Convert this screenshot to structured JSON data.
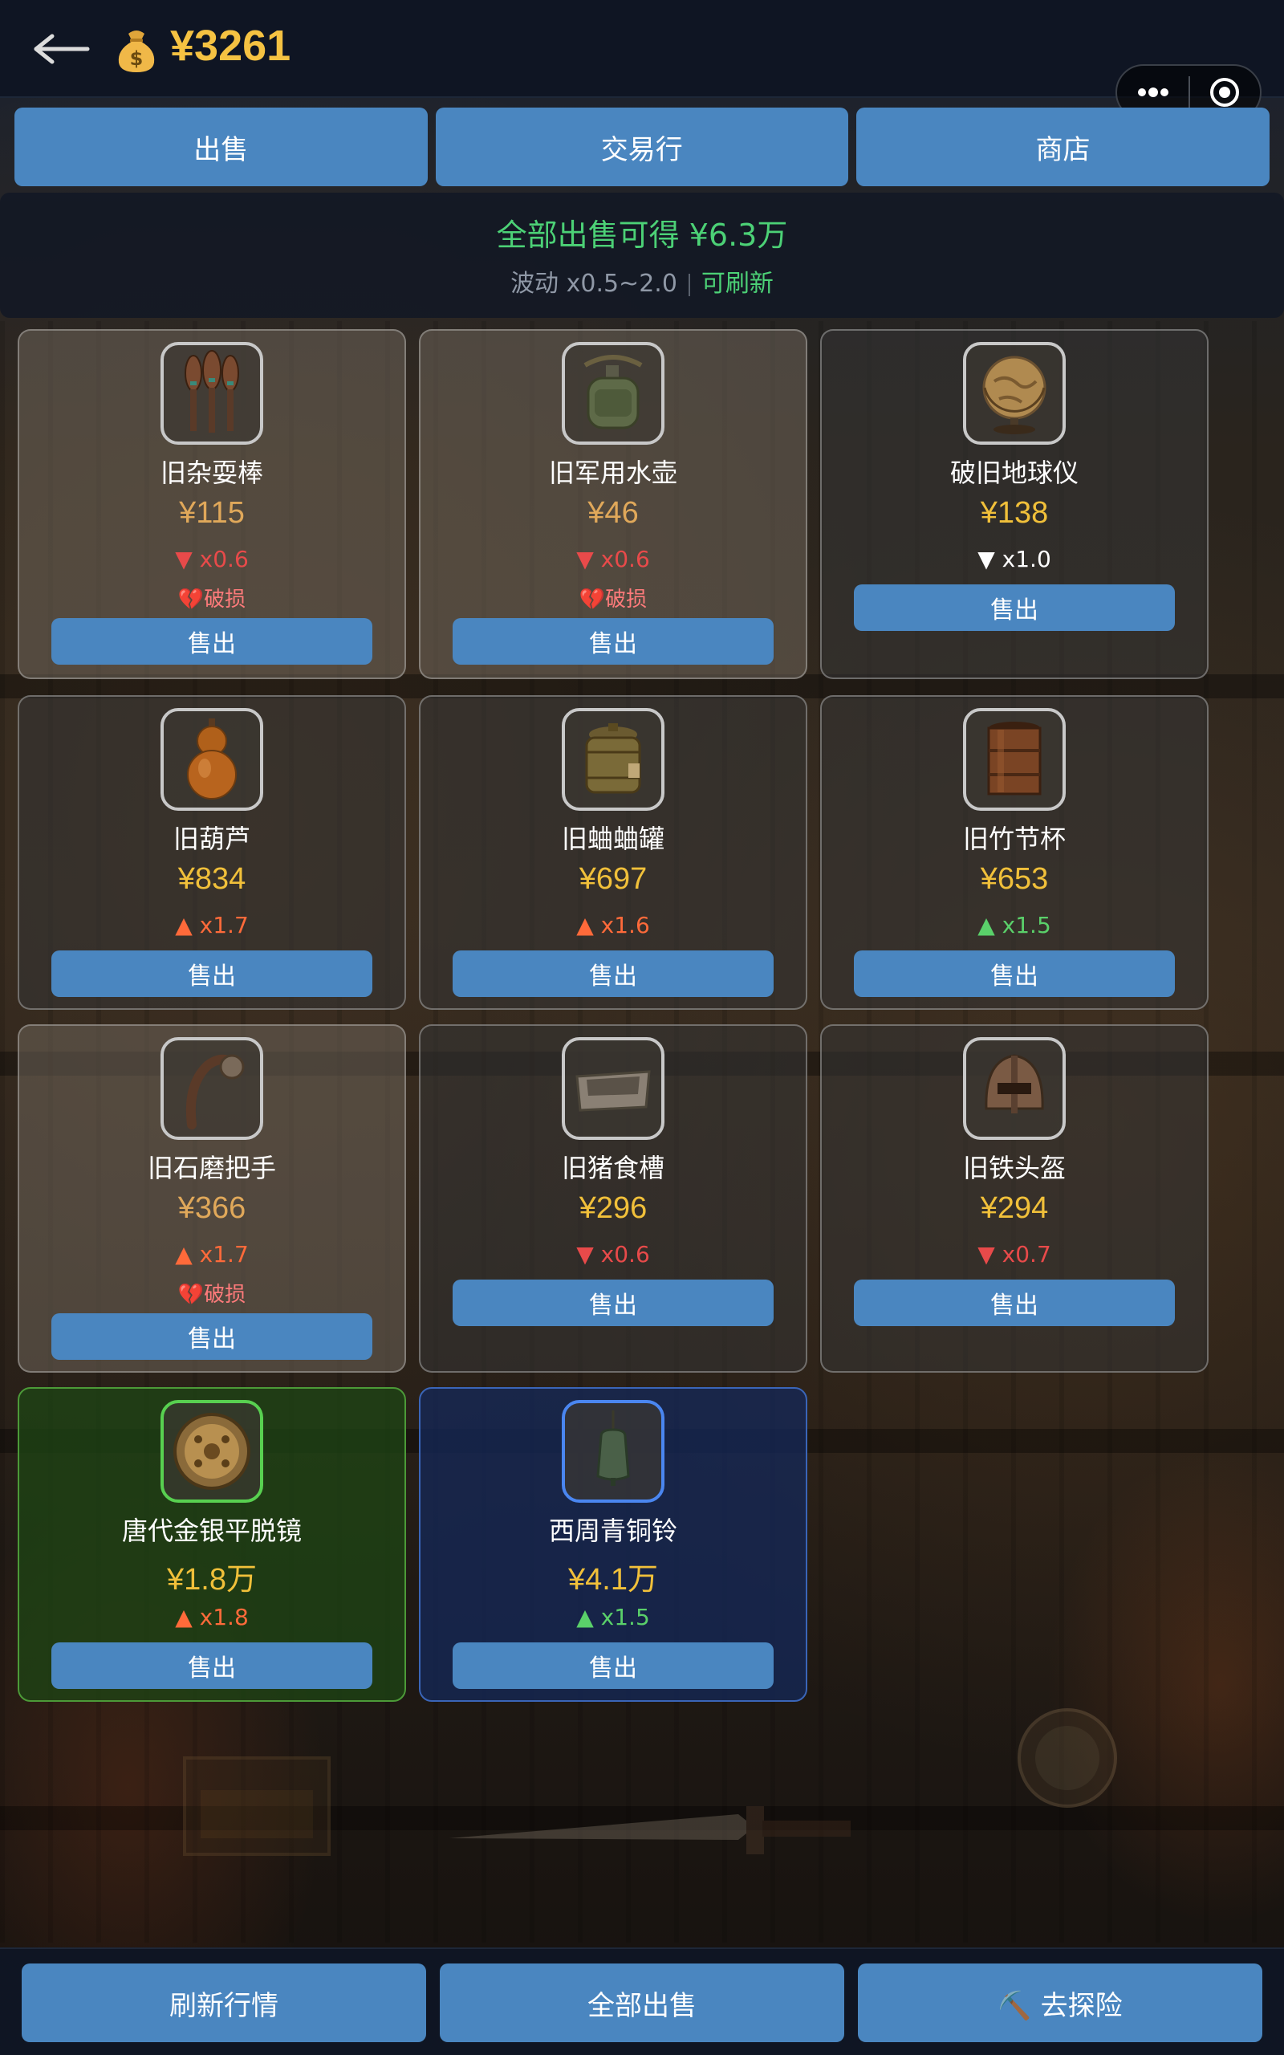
{
  "header": {
    "money_icon": "money-bag-icon",
    "money": "¥3261"
  },
  "tabs": [
    {
      "label": "出售"
    },
    {
      "label": "交易行"
    },
    {
      "label": "商店"
    }
  ],
  "summary": {
    "total": "全部出售可得 ¥6.3万",
    "fluctuation": "波动 x0.5~2.0",
    "refreshable": "可刷新"
  },
  "items": [
    {
      "name": "旧杂耍棒",
      "price": "¥115",
      "trend": "▼ x0.6",
      "trend_dir": "down",
      "damaged": "💔破损",
      "style": "dim",
      "icon": "juggling-clubs-icon"
    },
    {
      "name": "旧军用水壶",
      "price": "¥46",
      "trend": "▼ x0.6",
      "trend_dir": "down",
      "damaged": "💔破损",
      "style": "dim",
      "icon": "canteen-icon"
    },
    {
      "name": "破旧地球仪",
      "price": "¥138",
      "trend": "▼ x1.0",
      "trend_dir": "flat",
      "damaged": "",
      "style": "normal",
      "icon": "globe-icon"
    },
    {
      "name": "旧葫芦",
      "price": "¥834",
      "trend": "▲ x1.7",
      "trend_dir": "up-red",
      "damaged": "",
      "style": "normal",
      "icon": "gourd-icon"
    },
    {
      "name": "旧蛐蛐罐",
      "price": "¥697",
      "trend": "▲ x1.6",
      "trend_dir": "up-red",
      "damaged": "",
      "style": "normal",
      "icon": "cricket-jar-icon"
    },
    {
      "name": "旧竹节杯",
      "price": "¥653",
      "trend": "▲ x1.5",
      "trend_dir": "up-green",
      "damaged": "",
      "style": "normal",
      "icon": "bamboo-cup-icon"
    },
    {
      "name": "旧石磨把手",
      "price": "¥366",
      "trend": "▲ x1.7",
      "trend_dir": "up-red",
      "damaged": "💔破损",
      "style": "dim",
      "icon": "millstone-handle-icon"
    },
    {
      "name": "旧猪食槽",
      "price": "¥296",
      "trend": "▼ x0.6",
      "trend_dir": "down",
      "damaged": "",
      "style": "normal",
      "icon": "trough-icon"
    },
    {
      "name": "旧铁头盔",
      "price": "¥294",
      "trend": "▼ x0.7",
      "trend_dir": "down",
      "damaged": "",
      "style": "normal",
      "icon": "helmet-icon"
    },
    {
      "name": "唐代金银平脱镜",
      "price": "¥1.8万",
      "trend": "▲ x1.8",
      "trend_dir": "up-red",
      "damaged": "",
      "style": "green",
      "icon": "bronze-mirror-icon"
    },
    {
      "name": "西周青铜铃",
      "price": "¥4.1万",
      "trend": "▲ x1.5",
      "trend_dir": "up-green",
      "damaged": "",
      "style": "blue",
      "icon": "bronze-bell-icon"
    }
  ],
  "sell_label": "售出",
  "bottom": {
    "refresh": "刷新行情",
    "sell_all": "全部出售",
    "explore": "⛏️ 去探险"
  }
}
